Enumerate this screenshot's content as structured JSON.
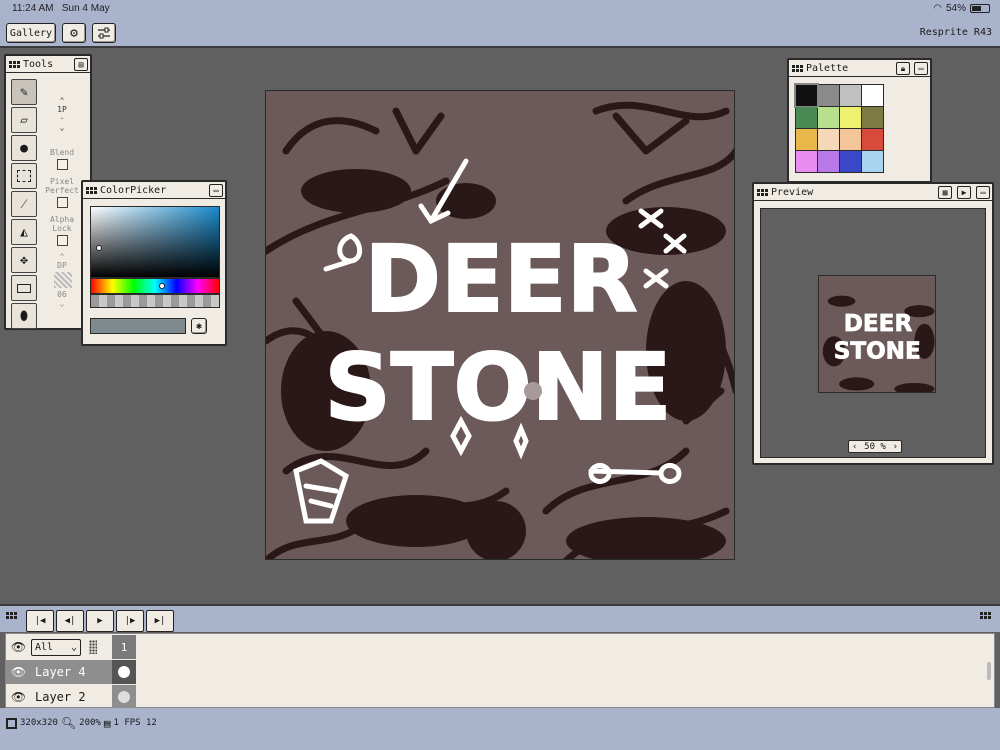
{
  "status": {
    "time": "11:24 AM",
    "date": "Sun 4 May",
    "battery": "54%",
    "battery_level": 0.54
  },
  "topbar": {
    "gallery_label": "Gallery",
    "settings_icon": "gear-icon",
    "adjust_icon": "sliders-icon",
    "app_version": "Resprite R43"
  },
  "tools_panel": {
    "title": "Tools",
    "tools": [
      "pencil-icon",
      "eraser-icon",
      "shade-icon",
      "select-rect-icon",
      "color-picker-icon",
      "fill-bucket-icon",
      "move-icon",
      "rectangle-icon",
      "dropper-icon"
    ],
    "brush_size": "1P",
    "options": {
      "blend": "Blend",
      "pixel_perfect": "Pixel Perfect",
      "alpha_lock": "Alpha Lock",
      "dp": "DP",
      "dp_value": "06"
    }
  },
  "colorpicker": {
    "title": "ColorPicker",
    "hex_value": ""
  },
  "palette": {
    "title": "Palette",
    "colors": [
      "#111111",
      "#8a8a8a",
      "#c0c0c0",
      "#ffffff",
      "#4a8a54",
      "#b8e08c",
      "#f0f070",
      "#7e7a44",
      "#e8b84a",
      "#f4d8b8",
      "#f4c49a",
      "#d84a3c",
      "#e88cf0",
      "#b878e8",
      "#3a48c8",
      "#a8d4f0"
    ]
  },
  "preview": {
    "title": "Preview",
    "zoom": "50 %"
  },
  "artwork": {
    "title_line1": "DEER",
    "title_line2": "STONE"
  },
  "timeline": {
    "filter": "All",
    "frame_number": "1"
  },
  "layers": [
    {
      "name": "Layer 4",
      "selected": true
    },
    {
      "name": "Layer 2",
      "selected": false
    }
  ],
  "bottom": {
    "canvas_size": "320x320",
    "zoom": "200%",
    "fps": "1 FPS 12"
  },
  "colors": {
    "chrome": "#a9b3cb",
    "panel": "#f0ece4",
    "workspace": "#606060",
    "art_bg": "#6c5959",
    "art_dark": "#2a1818"
  }
}
